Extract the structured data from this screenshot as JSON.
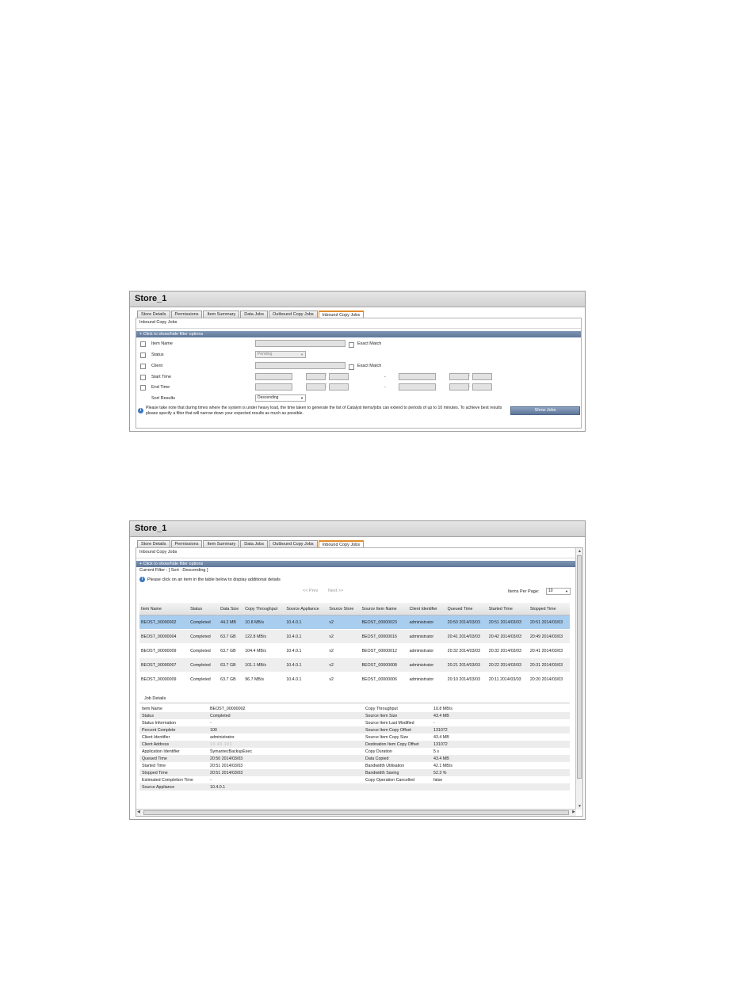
{
  "panel1": {
    "title": "Store_1",
    "tabs": [
      "Store Details",
      "Permissions",
      "Item Summary",
      "Data Jobs",
      "Outbound Copy Jobs",
      "Inbound Copy Jobs"
    ],
    "section_title": "Inbound Copy Jobs",
    "filter_toggle": "+ Click to show/hide filter options",
    "filters": {
      "item_name": "Item Name",
      "exact_match": "Exact Match",
      "status": "Status",
      "status_value": "Pending",
      "client": "Client",
      "exact_match_2": "Exact Match",
      "start_time": "Start Time",
      "end_time": "End Time",
      "sort_results": "Sort Results",
      "sort_value": "Descending",
      "dash": "-"
    },
    "note": "Please take note that during times where the system is under heavy load, the time taken to generate the list of Catalyst items/jobs can extend to periods of up to 10 minutes. To achieve best results please specify a filter that will narrow down your expected results as much as possible.",
    "show_jobs": "Show Jobs"
  },
  "panel2": {
    "title": "Store_1",
    "tabs": [
      "Store Details",
      "Permissions",
      "Item Summary",
      "Data Jobs",
      "Outbound Copy Jobs",
      "Inbound Copy Jobs"
    ],
    "section_title": "Inbound Copy Jobs",
    "filter_toggle": "+ Click to show/hide filter options",
    "current_filter": "Current Filter : [ Sort : Descending ]",
    "click_hint": "Please click on an item in the table below to display additional details",
    "prev": "<< Prev",
    "next": "Next >>",
    "items_per_page_label": "Items Per Page:",
    "items_per_page": "10",
    "columns": [
      "Item Name",
      "Status",
      "Data Size",
      "Copy Throughput",
      "Source Appliance",
      "Source Store",
      "Source Item Name",
      "Client Identifier",
      "Queued Time",
      "Started Time",
      "Stopped Time"
    ],
    "rows": [
      [
        "BEOST_00000002",
        "Completed",
        "44.2 MB",
        "10.8 MB/s",
        "10.4.0.1",
        "v2",
        "BEOST_00000023",
        "administrator",
        "20:50 2014/03/03",
        "20:51 2014/03/03",
        "20:51 2014/03/03"
      ],
      [
        "BEOST_00000004",
        "Completed",
        "63.7 GB",
        "122.8 MB/s",
        "10.4.0.1",
        "v2",
        "BEOST_00000016",
        "administrator",
        "20:41 2014/03/03",
        "20:42 2014/03/03",
        "20:49 2014/03/03"
      ],
      [
        "BEOST_00000009",
        "Completed",
        "63.7 GB",
        "104.4 MB/s",
        "10.4.0.1",
        "v2",
        "BEOST_00000012",
        "administrator",
        "20:32 2014/03/03",
        "20:32 2014/03/03",
        "20:41 2014/03/03"
      ],
      [
        "BEOST_00000007",
        "Completed",
        "63.7 GB",
        "101.1 MB/s",
        "10.4.0.1",
        "v2",
        "BEOST_00000008",
        "administrator",
        "20:21 2014/03/03",
        "20:22 2014/03/03",
        "20:31 2014/03/03"
      ],
      [
        "BEOST_00000009",
        "Completed",
        "63.7 GB",
        "96.7 MB/s",
        "10.4.0.1",
        "v2",
        "BEOST_00000006",
        "administrator",
        "20:10 2014/03/03",
        "20:11 2014/03/03",
        "20:20 2014/03/03"
      ]
    ],
    "job_details_title": "Job Details",
    "details": [
      [
        "Item Name",
        "BEOST_00000002",
        "Copy Throughput",
        "10.8 MB/s"
      ],
      [
        "Status",
        "Completed",
        "Source Item Size",
        "43.4 MB"
      ],
      [
        "Status Information",
        "-",
        "Source Item Last Modified",
        "-"
      ],
      [
        "Percent Complete",
        "100",
        "Source Item Copy Offset",
        "131072"
      ],
      [
        "Client Identifier",
        "administrator",
        "Source Item Copy Size",
        "43.4 MB"
      ],
      [
        "Client Address",
        "10.43.101",
        "Destination Item Copy Offset",
        "131072"
      ],
      [
        "Application Identifier",
        "SymantecBackupExec",
        "Copy Duration",
        "5 s"
      ],
      [
        "Queued Time",
        "20:50 2014/03/03",
        "Data Copied",
        "43.4 MB"
      ],
      [
        "Started Time",
        "20:51 2014/03/03",
        "Bandwidth Utilisation",
        "42.1 MB/s"
      ],
      [
        "Stopped Time",
        "20:51 2014/03/03",
        "Bandwidth Saving",
        "52.3 %"
      ],
      [
        "Estimated Completion Time",
        "-",
        "Copy Operation Cancelled",
        "false"
      ],
      [
        "Source Appliance",
        "10.4.0.1",
        "",
        ""
      ]
    ]
  }
}
